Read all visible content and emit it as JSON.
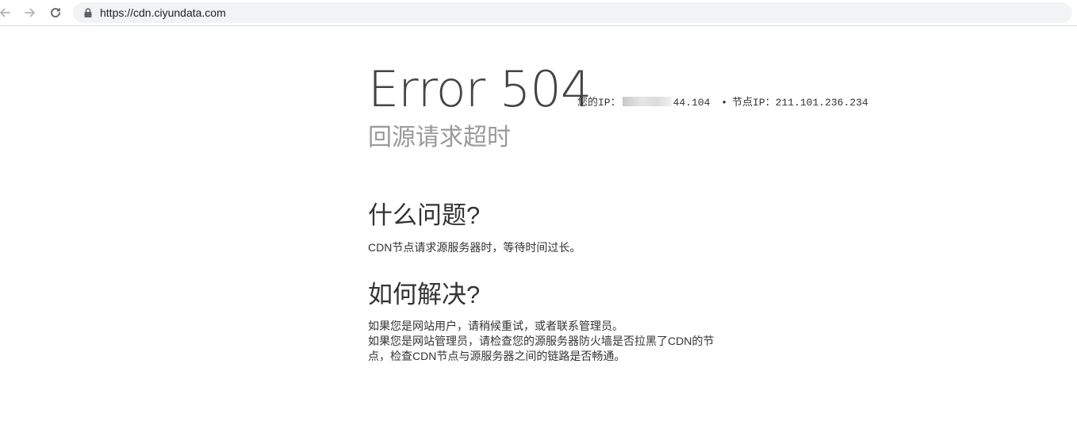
{
  "browser": {
    "url": "https://cdn.ciyundata.com",
    "icons": [
      "back-arrow-icon",
      "forward-arrow-icon",
      "reload-icon",
      "lock-icon"
    ]
  },
  "error": {
    "title": "Error 504",
    "subtitle": "回源请求超时",
    "your_ip_label": "您的IP：",
    "your_ip_visible_suffix": "44.104",
    "separator": "•",
    "node_ip_label": "节点IP：",
    "node_ip": "211.101.236.234"
  },
  "sections": {
    "what": {
      "heading": "什么问题?",
      "body": "CDN节点请求源服务器时，等待时间过长。"
    },
    "how": {
      "heading": "如何解决?",
      "lines": [
        "如果您是网站用户，请稍候重试，或者联系管理员。",
        "如果您是网站管理员，请检查您的源服务器防火墙是否拉黑了CDN的节",
        "点，检查CDN节点与源服务器之间的链路是否畅通。"
      ]
    }
  },
  "colors": {
    "title": "#444444",
    "subtitle": "#9a9a9a",
    "text": "#333333",
    "omnibox_bg": "#f1f3f4"
  }
}
